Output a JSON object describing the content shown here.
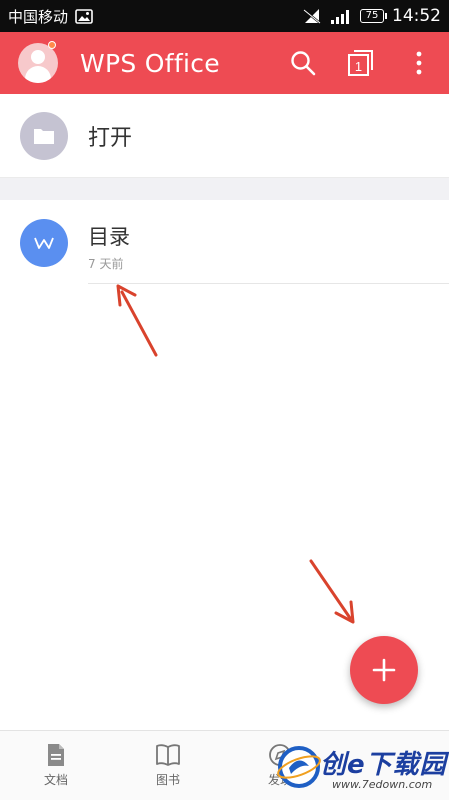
{
  "status_bar": {
    "carrier": "中国移动",
    "battery": "75",
    "time": "14:52"
  },
  "app_bar": {
    "title": "WPS Office",
    "icons": [
      "avatar",
      "search-icon",
      "multi-window-icon",
      "more-vert-icon"
    ],
    "window_count": "1",
    "color": "#ee4b53"
  },
  "open_row": {
    "label": "打开",
    "icon": "folder-icon"
  },
  "recent_files": [
    {
      "name": "目录",
      "time": "7 天前",
      "icon": "word-doc-icon",
      "icon_letter": "W",
      "icon_color": "#5a8ff0"
    }
  ],
  "fab": {
    "icon": "plus-icon"
  },
  "bottom_nav": [
    {
      "label": "文档",
      "icon": "document-icon"
    },
    {
      "label": "图书",
      "icon": "book-icon"
    },
    {
      "label": "发现",
      "icon": "discover-icon"
    }
  ],
  "watermark": {
    "text": "创e下载园",
    "url": "www.7edown.com"
  }
}
